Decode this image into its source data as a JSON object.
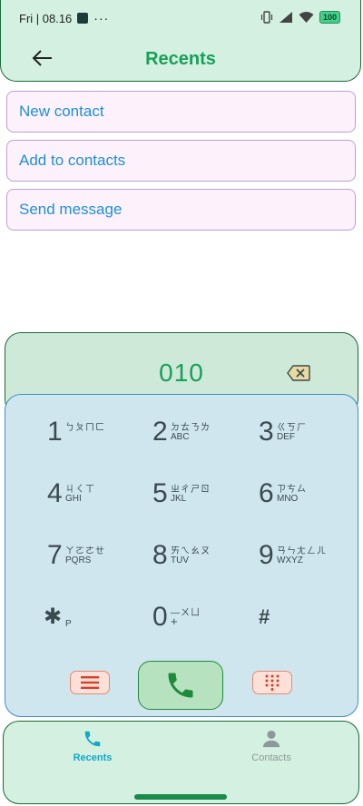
{
  "status": {
    "time": "Fri | 08.16",
    "more": "···",
    "battery": "100"
  },
  "header": {
    "title": "Recents"
  },
  "actions": [
    {
      "label": "New contact"
    },
    {
      "label": "Add to contacts"
    },
    {
      "label": "Send message"
    }
  ],
  "dialer": {
    "number": "010"
  },
  "keys": [
    {
      "digit": "1",
      "zhuyin": "ㄅㄆㄇㄈ",
      "letters": ""
    },
    {
      "digit": "2",
      "zhuyin": "ㄉㄊㄋㄌ",
      "letters": "ABC"
    },
    {
      "digit": "3",
      "zhuyin": "ㄍㄎㄏ",
      "letters": "DEF"
    },
    {
      "digit": "4",
      "zhuyin": "ㄐㄑㄒ",
      "letters": "GHI"
    },
    {
      "digit": "5",
      "zhuyin": "ㄓㄔㄕㄖ",
      "letters": "JKL"
    },
    {
      "digit": "6",
      "zhuyin": "ㄗㄘㄙ",
      "letters": "MNO"
    },
    {
      "digit": "7",
      "zhuyin": "ㄚㄛㄜㄝ",
      "letters": "PQRS"
    },
    {
      "digit": "8",
      "zhuyin": "ㄞㄟㄠㄡ",
      "letters": "TUV"
    },
    {
      "digit": "9",
      "zhuyin": "ㄢㄣㄤㄥㄦ",
      "letters": "WXYZ"
    },
    {
      "digit": "✱",
      "zhuyin": "",
      "letters": "P"
    },
    {
      "digit": "0",
      "zhuyin": "—ㄨㄩ",
      "letters": "+"
    },
    {
      "digit": "#",
      "zhuyin": "",
      "letters": ""
    }
  ],
  "nav": {
    "recents": {
      "label": "Recents",
      "color": "#12a8c8"
    },
    "contacts": {
      "label": "Contacts",
      "color": "#8a9a98"
    }
  },
  "colors": {
    "accent": "#17a05a",
    "link": "#1e90d6"
  }
}
